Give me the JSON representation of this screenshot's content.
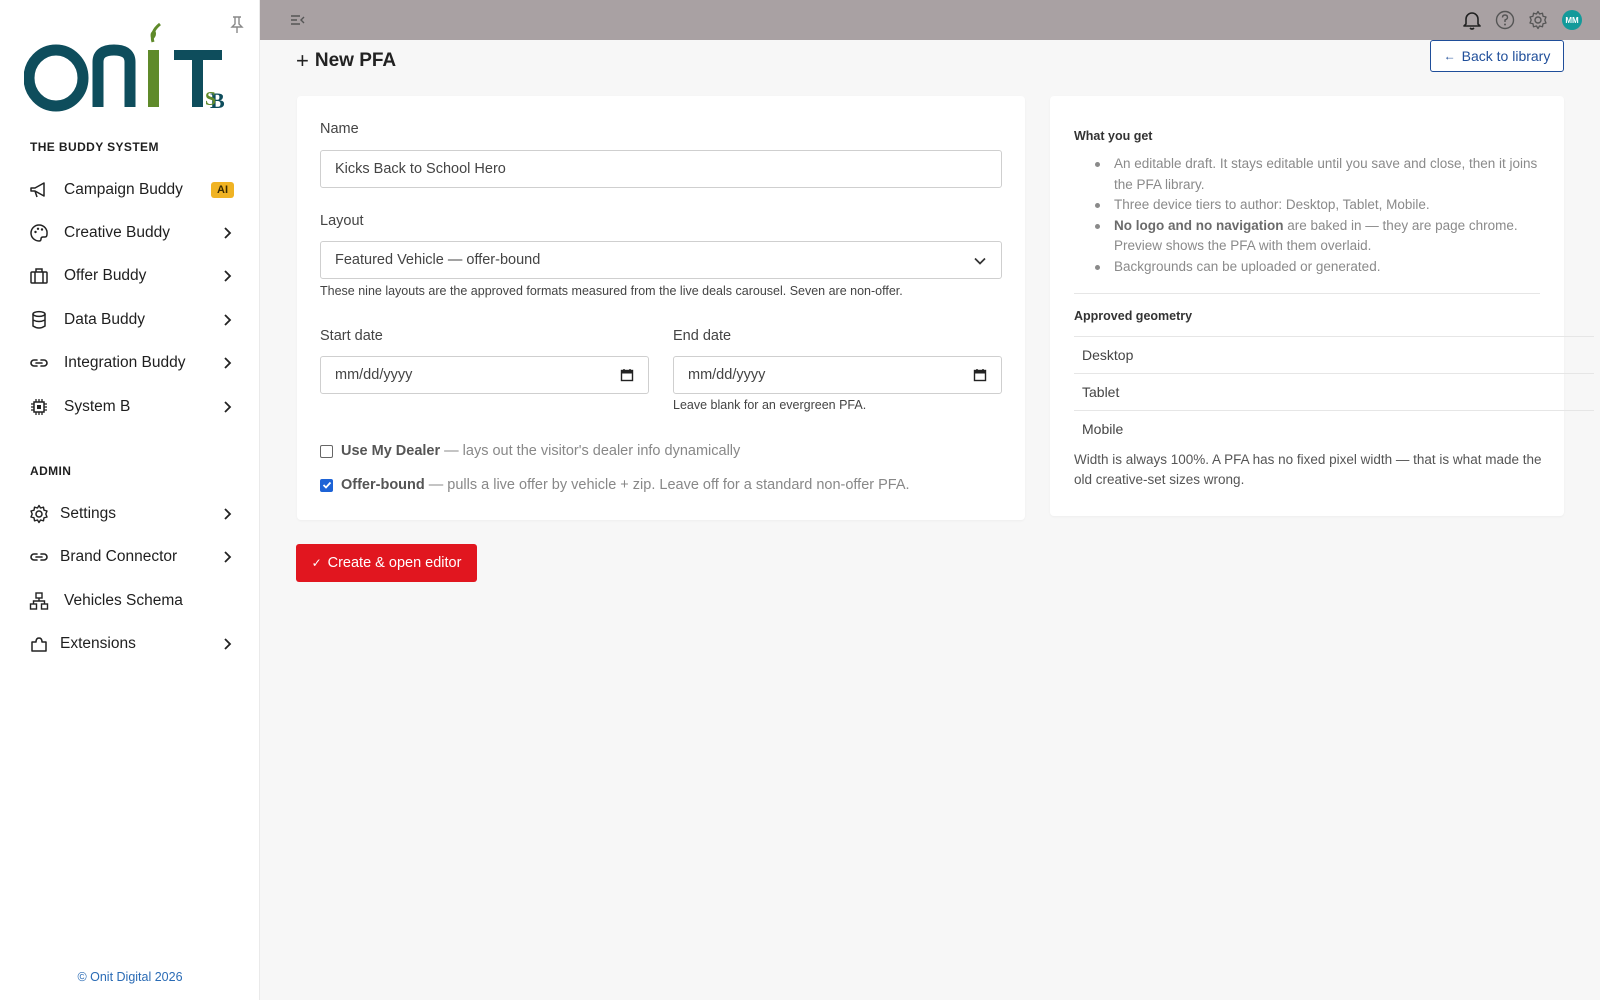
{
  "brand": {
    "logo_text": "ONiT",
    "logo_mark": "SB",
    "accent_teal": "#0e4d5c",
    "accent_green": "#5f8a2a"
  },
  "sidebar": {
    "section_main": "THE BUDDY SYSTEM",
    "items": [
      {
        "label": "Campaign Buddy",
        "icon": "megaphone-icon",
        "badge": "AI"
      },
      {
        "label": "Creative Buddy",
        "icon": "palette-icon"
      },
      {
        "label": "Offer Buddy",
        "icon": "briefcase-icon"
      },
      {
        "label": "Data Buddy",
        "icon": "database-icon"
      },
      {
        "label": "Integration Buddy",
        "icon": "link-icon"
      },
      {
        "label": "System B",
        "icon": "chip-icon"
      }
    ],
    "section_admin": "ADMIN",
    "admin_items": [
      {
        "label": "Settings",
        "icon": "gear-icon"
      },
      {
        "label": "Brand Connector",
        "icon": "link-icon"
      },
      {
        "label": "Vehicles Schema",
        "icon": "hierarchy-icon"
      },
      {
        "label": "Extensions",
        "icon": "puzzle-icon"
      }
    ],
    "footer": "© Onit Digital 2026"
  },
  "topbar": {
    "avatar_initials": "MM",
    "avatar_color": "#139a9a",
    "background": "#a9a1a3"
  },
  "page": {
    "title": "New PFA",
    "back_label": "Back to library"
  },
  "form": {
    "name_label": "Name",
    "name_value": "Kicks Back to School Hero",
    "layout_label": "Layout",
    "layout_value": "Featured Vehicle — offer-bound",
    "layout_help": "These nine layouts are the approved formats measured from the live deals carousel. Seven are non-offer.",
    "start_label": "Start date",
    "start_placeholder": "mm/dd/yyyy",
    "end_label": "End date",
    "end_placeholder": "mm/dd/yyyy",
    "end_help": "Leave blank for an evergreen PFA.",
    "dealer_strong": "Use My Dealer",
    "dealer_rest": "— lays out the visitor's dealer info dynamically",
    "dealer_checked": false,
    "offer_strong": "Offer-bound",
    "offer_rest": "— pulls a live offer by vehicle + zip. Leave off for a standard non-offer PFA.",
    "offer_checked": true,
    "submit_label": "Create & open editor",
    "submit_color": "#e1161f"
  },
  "info": {
    "heading": "What you get",
    "bullet1": "An editable draft. It stays editable until you save and close, then it joins the PFA library.",
    "bullet2": "Three device tiers to author: Desktop, Tablet, Mobile.",
    "bullet3_strong": "No logo and no navigation",
    "bullet3_rest": " are baked in — they are page chrome. Preview shows the PFA with them overlaid.",
    "bullet4": "Backgrounds can be uploaded or generated.",
    "geometry_heading": "Approved geometry",
    "geometry_rows": [
      "Desktop",
      "Tablet",
      "Mobile"
    ],
    "note": "Width is always 100%. A PFA has no fixed pixel width — that is what made the old creative-set sizes wrong."
  }
}
